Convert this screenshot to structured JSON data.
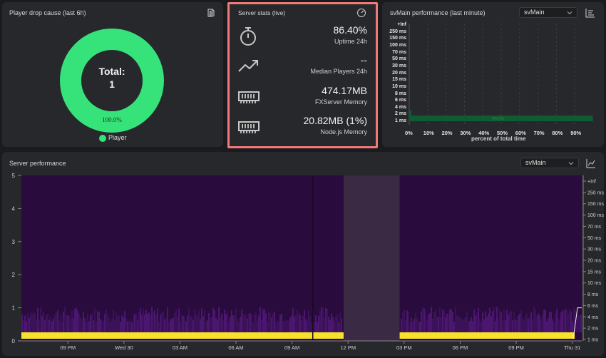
{
  "drop_card": {
    "title": "Player drop cause (last 6h)",
    "donut_label_line1": "Total:",
    "donut_label_line2": "1",
    "slice_percent": "100.0%",
    "legend_label": "Player",
    "slice_color": "#36e27a"
  },
  "stats_card": {
    "title": "Server stats (live)",
    "highlight_color": "#f07a7a",
    "rows": [
      {
        "icon": "stopwatch-icon",
        "value": "86.40%",
        "label": "Uptime 24h"
      },
      {
        "icon": "trending-up-icon",
        "value": "--",
        "label": "Median Players 24h"
      },
      {
        "icon": "memory-icon",
        "value": "474.17MB",
        "label": "FXServer Memory"
      },
      {
        "icon": "memory-icon",
        "value": "20.82MB (1%)",
        "label": "Node.js Memory"
      }
    ]
  },
  "svmain_card": {
    "title": "svMain performance (last minute)",
    "select_value": "svMain",
    "bucket_labels": [
      "+Inf",
      "250 ms",
      "150 ms",
      "100 ms",
      "70 ms",
      "50 ms",
      "30 ms",
      "20 ms",
      "15 ms",
      "10 ms",
      "8 ms",
      "6 ms",
      "4 ms",
      "2 ms",
      "1 ms"
    ],
    "x_ticks": [
      "0%",
      "10%",
      "20%",
      "30%",
      "40%",
      "50%",
      "60%",
      "70%",
      "80%",
      "90%"
    ],
    "x_label": "percent of total time",
    "bar_label": "99.5%"
  },
  "perf_card": {
    "title": "Server performance",
    "select_value": "svMain",
    "y_left": [
      "5",
      "4",
      "3",
      "2",
      "1",
      "0"
    ],
    "y_right": [
      "+Inf",
      "250 ms",
      "150 ms",
      "100 ms",
      "70 ms",
      "50 ms",
      "30 ms",
      "20 ms",
      "15 ms",
      "10 ms",
      "8 ms",
      "6 ms",
      "4 ms",
      "2 ms",
      "1 ms"
    ],
    "x_ticks": [
      "09 PM",
      "Wed 30",
      "03 AM",
      "06 AM",
      "09 AM",
      "12 PM",
      "03 PM",
      "06 PM",
      "09 PM",
      "Thu 31"
    ]
  }
}
